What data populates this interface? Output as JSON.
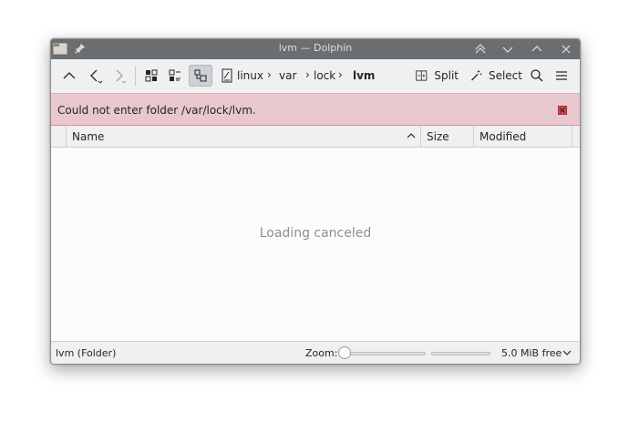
{
  "window": {
    "title": "lvm — Dolphin"
  },
  "titlebar": {
    "app_icon": "folder-icon",
    "pin_icon": "pin-icon",
    "buttons": [
      "keep-above-icon",
      "minimize-icon",
      "maximize-icon",
      "close-icon"
    ]
  },
  "toolbar": {
    "split_label": "Split",
    "select_label": "Select",
    "breadcrumbs": [
      "linux",
      "var",
      "lock",
      "lvm"
    ],
    "separator": "›"
  },
  "banner": {
    "message": "Could not enter folder /var/lock/lvm.",
    "color": "#e9c8cd",
    "close_color": "#da4453"
  },
  "columns": {
    "name": "Name",
    "size": "Size",
    "modified": "Modified"
  },
  "content": {
    "placeholder": "Loading canceled"
  },
  "statusbar": {
    "status": "lvm (Folder)",
    "zoom_label": "Zoom:",
    "zoom_level": 0,
    "free_space": "5.0 MiB free"
  }
}
